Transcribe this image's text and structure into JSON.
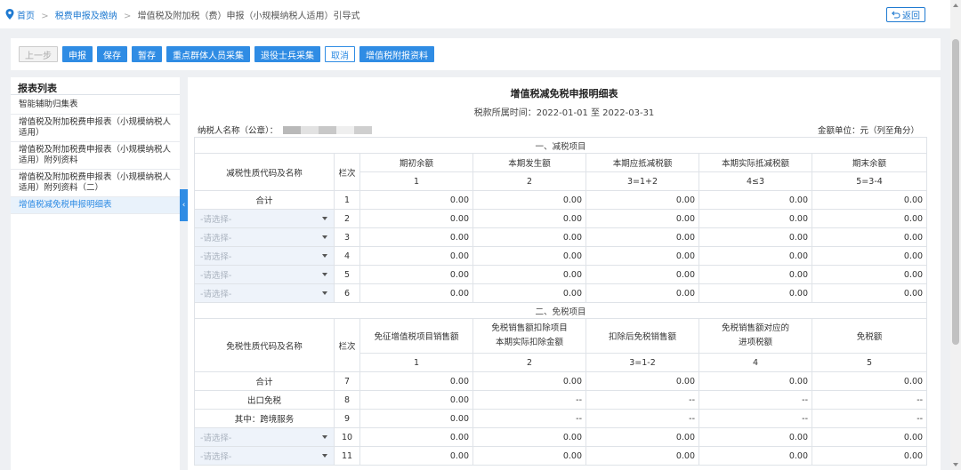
{
  "breadcrumb": {
    "home": "首页",
    "level1": "税费申报及缴纳",
    "current": "增值税及附加税（费）申报（小规模纳税人适用）引导式",
    "back_label": "返回"
  },
  "toolbar": {
    "prev": "上一步",
    "declare": "申报",
    "save": "保存",
    "temp_save": "暂存",
    "key_group": "重点群体人员采集",
    "veteran": "退役士兵采集",
    "cancel": "取消",
    "vat_attach": "增值税附报资料"
  },
  "sidebar": {
    "title": "报表列表",
    "items": [
      {
        "label": "智能辅助归集表"
      },
      {
        "label": "增值税及附加税费申报表（小规模纳税人适用）"
      },
      {
        "label": "增值税及附加税费申报表（小规模纳税人适用）附列资料"
      },
      {
        "label": "增值税及附加税费申报表（小规模纳税人适用）附列资料（二）"
      },
      {
        "label": "增值税减免税申报明细表"
      }
    ]
  },
  "report": {
    "title": "增值税减免税申报明细表",
    "period": "税款所属时间：2022-01-01 至 2022-03-31",
    "taxpayer_label": "纳税人名称（公章）：",
    "unit": "金额单位：元（列至角分）",
    "select_placeholder": "-请选择-",
    "section1": {
      "title": "一、减税项目",
      "row_header": "减税性质代码及名称",
      "seq_header": "栏次",
      "cols": [
        "期初余额",
        "本期发生额",
        "本期应抵减税额",
        "本期实际抵减税额",
        "期末余额"
      ],
      "col_nums": [
        "1",
        "2",
        "3=1+2",
        "4≤3",
        "5=3-4"
      ],
      "total_label": "合计",
      "rows": [
        {
          "seq": "1",
          "values": [
            "0.00",
            "0.00",
            "0.00",
            "0.00",
            "0.00"
          ]
        },
        {
          "seq": "2",
          "values": [
            "0.00",
            "0.00",
            "0.00",
            "0.00",
            "0.00"
          ]
        },
        {
          "seq": "3",
          "values": [
            "0.00",
            "0.00",
            "0.00",
            "0.00",
            "0.00"
          ]
        },
        {
          "seq": "4",
          "values": [
            "0.00",
            "0.00",
            "0.00",
            "0.00",
            "0.00"
          ]
        },
        {
          "seq": "5",
          "values": [
            "0.00",
            "0.00",
            "0.00",
            "0.00",
            "0.00"
          ]
        },
        {
          "seq": "6",
          "values": [
            "0.00",
            "0.00",
            "0.00",
            "0.00",
            "0.00"
          ]
        }
      ]
    },
    "section2": {
      "title": "二、免税项目",
      "row_header": "免税性质代码及名称",
      "seq_header": "栏次",
      "col1": "免征增值税项目销售额",
      "col2_line1": "免税销售额扣除项目",
      "col2_line2": "本期实际扣除金额",
      "col3": "扣除后免税销售额",
      "col4_line1": "免税销售额对应的",
      "col4_line2": "进项税额",
      "col5": "免税额",
      "col_nums": [
        "1",
        "2",
        "3=1-2",
        "4",
        "5"
      ],
      "total_label": "合计",
      "export_label": "出口免税",
      "crossborder_label": "其中：跨境服务",
      "rows": [
        {
          "seq": "7",
          "values": [
            "0.00",
            "0.00",
            "0.00",
            "0.00",
            "0.00"
          ]
        },
        {
          "seq": "8",
          "values": [
            "0.00",
            "--",
            "--",
            "--",
            "--"
          ]
        },
        {
          "seq": "9",
          "values": [
            "0.00",
            "--",
            "--",
            "--",
            "--"
          ]
        },
        {
          "seq": "10",
          "values": [
            "0.00",
            "0.00",
            "0.00",
            "0.00",
            "0.00"
          ]
        },
        {
          "seq": "11",
          "values": [
            "0.00",
            "0.00",
            "0.00",
            "0.00",
            "0.00"
          ]
        }
      ]
    }
  }
}
